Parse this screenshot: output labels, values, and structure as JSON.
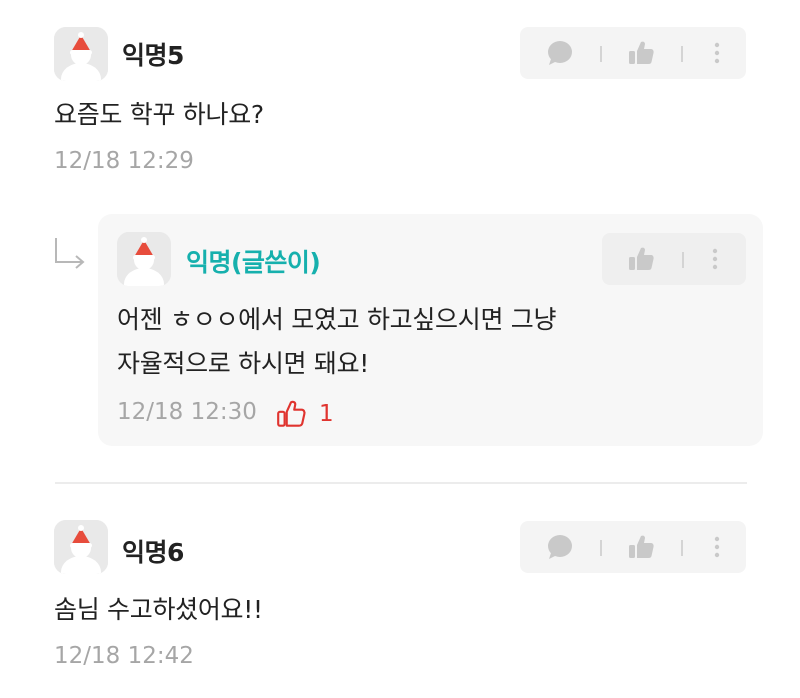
{
  "comments": [
    {
      "author": "익명5",
      "text": "요즘도 학꾸 하나요?",
      "time": "12/18 12:29",
      "actions": [
        "comment-icon",
        "thumbs-up-icon",
        "more-vertical-icon"
      ]
    },
    {
      "author": "익명6",
      "text": "솜님 수고하셨어요!!",
      "time": "12/18 12:42",
      "actions": [
        "comment-icon",
        "thumbs-up-icon",
        "more-vertical-icon"
      ]
    }
  ],
  "reply": {
    "author": "익명(글쓴이)",
    "lines": [
      "어젠 ㅎㅇㅇ에서 모였고 하고싶으시면 그냥",
      "자율적으로 하시면 돼요!"
    ],
    "time": "12/18 12:30",
    "likes": "1",
    "actions": [
      "thumbs-up-icon",
      "more-vertical-icon"
    ],
    "indicator_icon": "reply-arrow-icon"
  },
  "colors": {
    "op_author": "#16b0ad",
    "like_active": "#e0342f",
    "timestamp": "#a6a6a6",
    "icon_inactive": "#c9c9c9",
    "action_bar_bg": "#f4f4f4",
    "reply_bg": "#f7f7f7"
  }
}
